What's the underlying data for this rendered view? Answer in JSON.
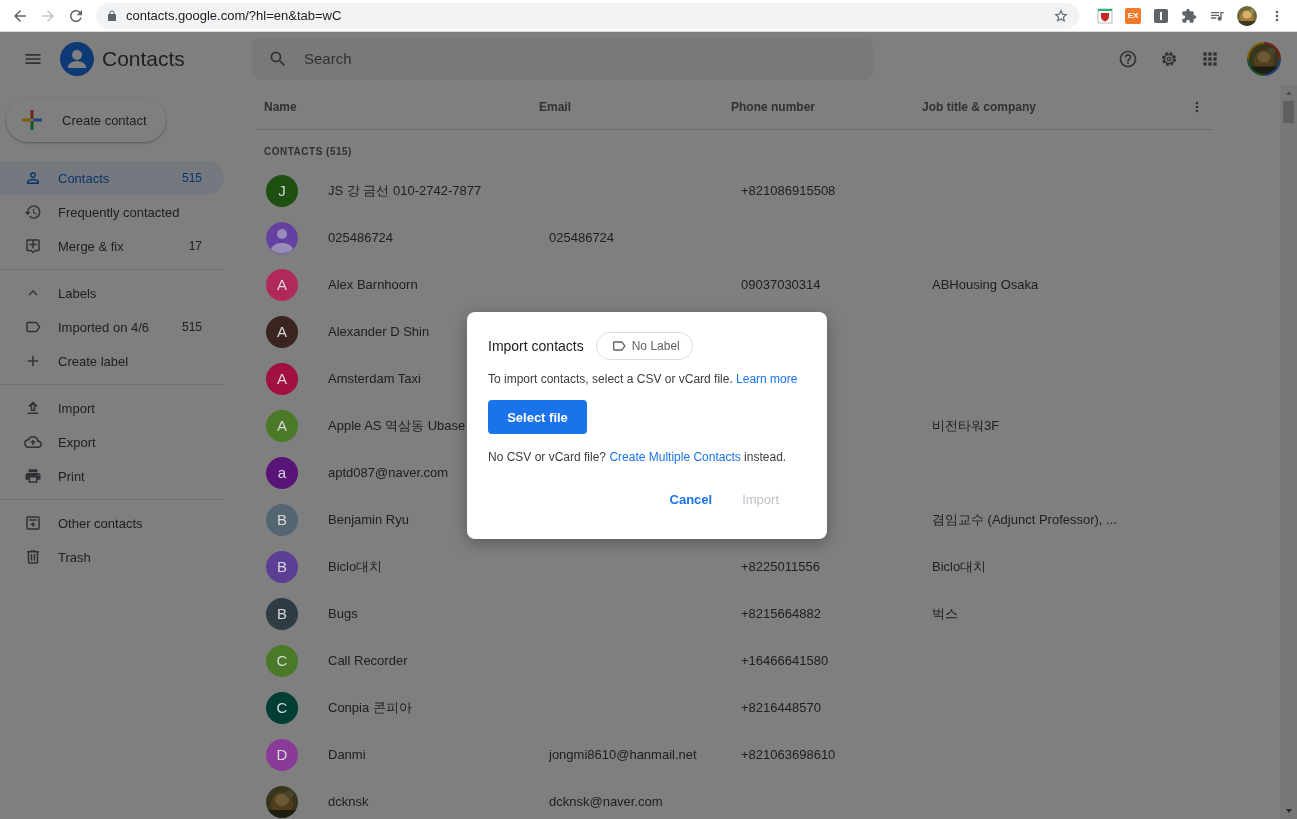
{
  "browser": {
    "url": "contacts.google.com/?hl=en&tab=wC",
    "forward_disabled": true,
    "extension_text": "EX"
  },
  "app": {
    "title": "Contacts",
    "search": {
      "placeholder": "Search"
    }
  },
  "sidebar": {
    "create_button": "Create contact",
    "primary": [
      {
        "label": "Contacts",
        "count": "515",
        "selected": true
      },
      {
        "label": "Frequently contacted",
        "selected": false
      },
      {
        "label": "Merge & fix",
        "count": "17",
        "selected": false
      }
    ],
    "labels": {
      "title": "Labels",
      "expanded": true,
      "items": [
        {
          "label": "Imported on 4/6",
          "count": "515",
          "selected": false
        }
      ],
      "create": "Create label"
    },
    "tools": [
      {
        "label": "Import",
        "selected": false
      },
      {
        "label": "Export",
        "selected": false
      },
      {
        "label": "Print",
        "selected": false
      }
    ],
    "more": [
      {
        "label": "Other contacts",
        "selected": false
      },
      {
        "label": "Trash",
        "selected": false
      }
    ]
  },
  "table": {
    "columns": [
      "Name",
      "Email",
      "Phone number",
      "Job title & company"
    ],
    "section": "CONTACTS (515)",
    "rows": [
      {
        "avatar": {
          "kind": "letter",
          "letter": "J",
          "color": "#1e5012"
        },
        "name": "JS 강 금선 010-2742-7877",
        "phone": "+821086915508"
      },
      {
        "avatar": {
          "kind": "person",
          "color": "#6440a0"
        },
        "name": "025486724",
        "email": "025486724"
      },
      {
        "avatar": {
          "kind": "letter",
          "letter": "A",
          "color": "#b0295a"
        },
        "name": "Alex Barnhoorn",
        "phone": "09037030314",
        "job": "ABHousing Osaka"
      },
      {
        "avatar": {
          "kind": "letter",
          "letter": "A",
          "color": "#3a2420"
        },
        "name": "Alexander D Shin"
      },
      {
        "avatar": {
          "kind": "letter",
          "letter": "A",
          "color": "#a01040"
        },
        "name": "Amsterdam Taxi"
      },
      {
        "avatar": {
          "kind": "letter",
          "letter": "A",
          "color": "#4a7a28"
        },
        "name": "Apple AS 역삼동 Ubase",
        "job": "비전타워3F"
      },
      {
        "avatar": {
          "kind": "letter",
          "letter": "a",
          "color": "#5a1478"
        },
        "name": "aptd087@naver.com"
      },
      {
        "avatar": {
          "kind": "letter",
          "letter": "B",
          "color": "#536570"
        },
        "name": "Benjamin Ryu",
        "job": "겸임교수 (Adjunct Professor), ..."
      },
      {
        "avatar": {
          "kind": "letter",
          "letter": "B",
          "color": "#5c3f95"
        },
        "name": "Biclo대치",
        "phone": "+8225011556",
        "job": "Biclo대치"
      },
      {
        "avatar": {
          "kind": "letter",
          "letter": "B",
          "color": "#2f3c44"
        },
        "name": "Bugs",
        "phone": "+8215664882",
        "job": "벅스"
      },
      {
        "avatar": {
          "kind": "letter",
          "letter": "C",
          "color": "#4a7a28"
        },
        "name": "Call Recorder",
        "phone": "+16466641580"
      },
      {
        "avatar": {
          "kind": "letter",
          "letter": "C",
          "color": "#003d33"
        },
        "name": "Conpia 콘피아",
        "phone": "+8216448570"
      },
      {
        "avatar": {
          "kind": "letter",
          "letter": "D",
          "color": "#8a3a98"
        },
        "name": "Danmi",
        "email": "jongmi8610@hanmail.net",
        "phone": "+821063698610"
      },
      {
        "name": "dcknsk",
        "email": "dcknsk@naver.com"
      }
    ]
  },
  "dialog": {
    "title": "Import contacts",
    "chip": "No Label",
    "text": "To import contacts, select a CSV or vCard file.",
    "text_link": "Learn more",
    "primary_button": "Select file",
    "alt_text": "No CSV or vCard file?",
    "alt_link": "Create Multiple Contacts",
    "alt_suffix": "instead.",
    "buttons": [
      {
        "label": "Cancel",
        "disabled": false
      },
      {
        "label": "Import",
        "disabled": true
      }
    ]
  }
}
